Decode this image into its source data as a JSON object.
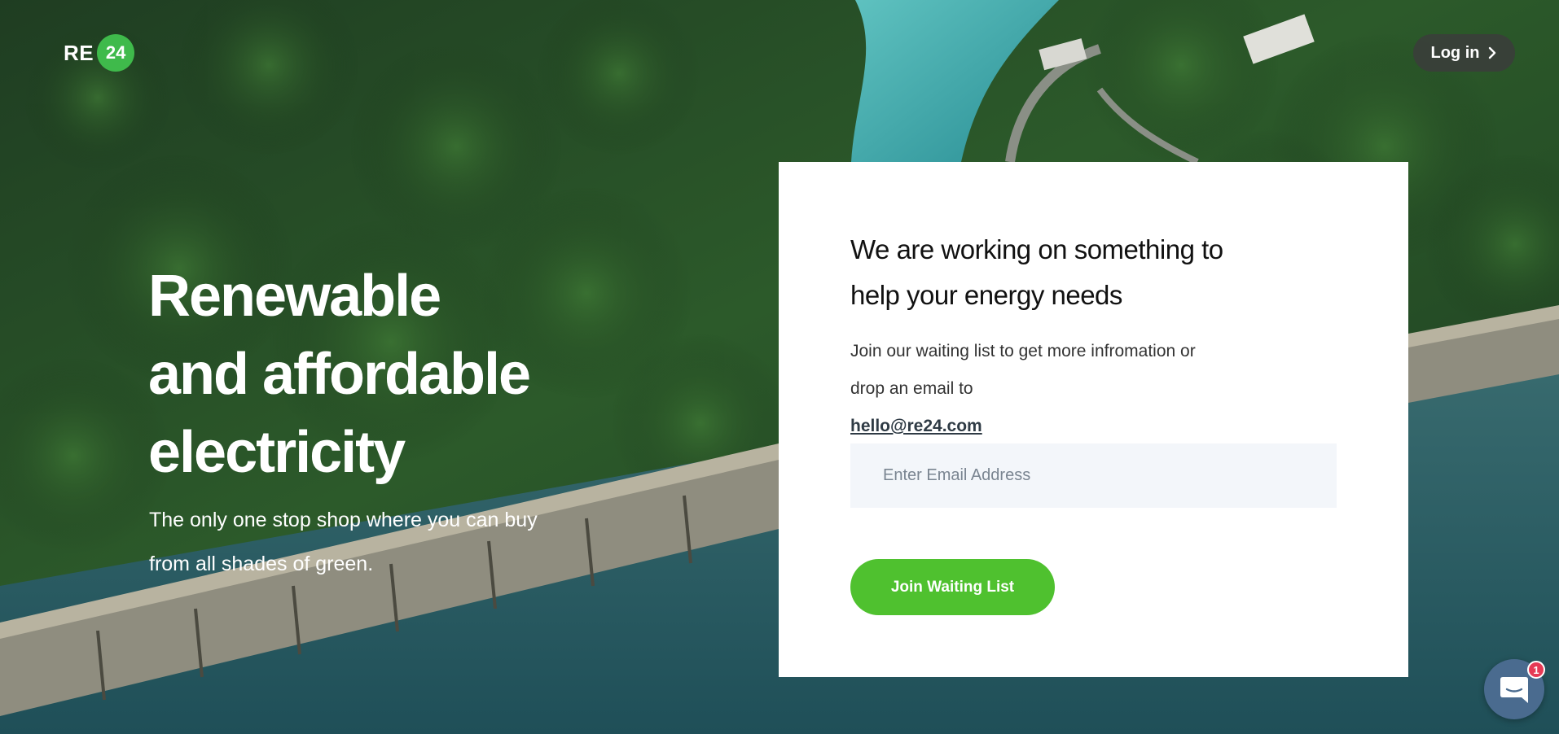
{
  "header": {
    "logo_text": "RE",
    "logo_badge": "24",
    "login_label": "Log in"
  },
  "hero": {
    "title_lines": [
      "Renewable",
      "and affordable",
      "electricity"
    ],
    "subtitle_lines": [
      "The only one stop shop where you can buy",
      "from all shades of green."
    ]
  },
  "card": {
    "title_lines": [
      "We are working on something to",
      "help your energy needs"
    ],
    "desc_line1": "Join our waiting list to get more infromation or",
    "desc_line2_prefix": "drop an email to ",
    "email_link": "hello@re24.com",
    "email_placeholder": "Enter Email Address",
    "join_label": "Join Waiting List"
  },
  "chat": {
    "badge_count": "1"
  },
  "colors": {
    "brand_green": "#3fba4b",
    "button_green": "#4fc12f",
    "chat_blue": "#4a6b8f",
    "badge_red": "#e53a55"
  },
  "icons": {
    "login": "chevron-right-icon",
    "chat": "chat-bubble-icon"
  }
}
